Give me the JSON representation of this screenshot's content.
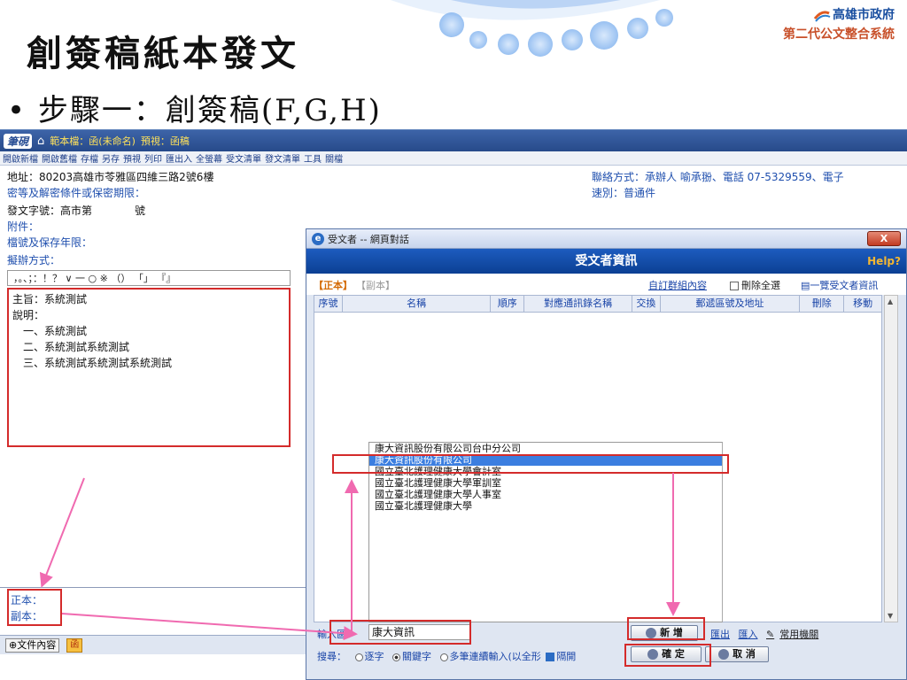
{
  "slide": {
    "title": "創簽稿紙本發文",
    "bullet": "• 步驟一：創簽稿(F,G,H)",
    "logo_line1": "高雄市政府",
    "logo_line2": "第二代公文整合系統"
  },
  "app": {
    "brand": "筆硯",
    "template": "範本檔：函(未命名)",
    "preview": "預視：函稿",
    "toolbar": [
      "開啟新檔",
      "開啟舊檔",
      "存檔",
      "另存",
      "預視",
      "列印",
      "匯出入",
      "全螢幕",
      "受文清單",
      "發文清單",
      "工具",
      "關檔"
    ]
  },
  "doc": {
    "address": "地址：80203高雄市苓雅區四維三路2號6樓",
    "secret": "密等及解密條件或保密期限：",
    "doc_no": "發文字號：高市第　　　　號",
    "attach": "附件：",
    "archive": "檔號及保存年限：",
    "method": "擬辦方式：",
    "contact": "聯絡方式：承辦人 喻承翂、電話 07-5329559、電子",
    "speed": "速別：普通件",
    "punct": "，。、；：！？ ∨ 一 ○ ※ （） 「」 『』",
    "editor_lines": [
      "主旨：系統測試",
      "說明：",
      "　一、系統測試",
      "　二、系統測試系統測試",
      "　三、系統測試系統測試系統測試"
    ],
    "zhengben": "正本：",
    "fuben": "副本：",
    "status_btn": "文件內容",
    "status_icon": "函"
  },
  "dialog": {
    "window_title": "受文者 -- 網頁對話",
    "close": "X",
    "header": "受文者資訊",
    "help": "Help",
    "tab_main": "【正本】",
    "tab_copy": "【副本】",
    "custom_group": "自訂群組內容",
    "delete_all": "刪除全選",
    "list_all": "一覽受文者資訊",
    "columns": [
      "序號",
      "名稱",
      "順序",
      "對應通訊錄名稱",
      "交換",
      "郵遞區號及地址",
      "刪除",
      "移動"
    ],
    "suggestions": [
      "康大資訊股份有限公司台中分公司",
      "康大資訊股份有限公司",
      "國立臺北護理健康大學會計室",
      "國立臺北護理健康大學軍訓室",
      "國立臺北護理健康大學人事室",
      "國立臺北護理健康大學"
    ],
    "input_label": "輸入區：",
    "input_value": "康大資訊",
    "add_btn": "新 增",
    "export": "匯出",
    "import": "匯入",
    "common": "常用機關",
    "search_label": "搜尋：",
    "search_opts": [
      "逐字",
      "關鍵字",
      "多筆連續輸入(以全形",
      "隔開"
    ],
    "ok_btn": "確 定",
    "cancel_btn": "取 消"
  }
}
